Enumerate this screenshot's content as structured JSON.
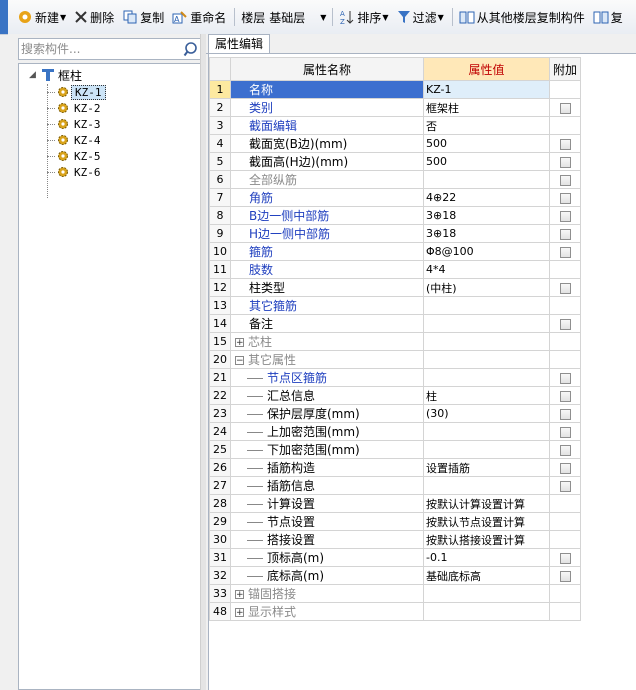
{
  "toolbar": {
    "new_label": "新建",
    "delete_label": "删除",
    "copy_label": "复制",
    "rename_label": "重命名",
    "floor_label": "楼层",
    "floor_value": "基础层",
    "sort_label": "排序",
    "filter_label": "过滤",
    "copy_from_floor_label": "从其他楼层复制构件",
    "last_label": "复"
  },
  "search": {
    "placeholder": "搜索构件..."
  },
  "tree": {
    "root_label": "框柱",
    "items": [
      {
        "label": "KZ-1",
        "selected": true
      },
      {
        "label": "KZ-2",
        "selected": false
      },
      {
        "label": "KZ-3",
        "selected": false
      },
      {
        "label": "KZ-4",
        "selected": false
      },
      {
        "label": "KZ-5",
        "selected": false
      },
      {
        "label": "KZ-6",
        "selected": false
      }
    ]
  },
  "panel": {
    "tab_label": "属性编辑",
    "headers": {
      "num": "",
      "name": "属性名称",
      "value": "属性值",
      "extra": "附加"
    }
  },
  "rows": [
    {
      "num": "1",
      "name": "名称",
      "value": "KZ-1",
      "color": "blue",
      "check": false,
      "selected": true
    },
    {
      "num": "2",
      "name": "类别",
      "value": "框架柱",
      "color": "blue",
      "check": true
    },
    {
      "num": "3",
      "name": "截面编辑",
      "value": "否",
      "color": "blue",
      "check": false
    },
    {
      "num": "4",
      "name": "截面宽(B边)(mm)",
      "value": "500",
      "color": "black",
      "check": true
    },
    {
      "num": "5",
      "name": "截面高(H边)(mm)",
      "value": "500",
      "color": "black",
      "check": true
    },
    {
      "num": "6",
      "name": "全部纵筋",
      "value": "",
      "color": "gray",
      "check": true
    },
    {
      "num": "7",
      "name": "角筋",
      "value": "4⊕22",
      "color": "blue",
      "check": true
    },
    {
      "num": "8",
      "name": "B边一侧中部筋",
      "value": "3⊕18",
      "color": "blue",
      "check": true
    },
    {
      "num": "9",
      "name": "H边一侧中部筋",
      "value": "3⊕18",
      "color": "blue",
      "check": true
    },
    {
      "num": "10",
      "name": "箍筋",
      "value": "Φ8@100",
      "color": "blue",
      "check": true
    },
    {
      "num": "11",
      "name": "肢数",
      "value": "4*4",
      "color": "blue",
      "check": false
    },
    {
      "num": "12",
      "name": "柱类型",
      "value": "(中柱)",
      "color": "black",
      "check": true
    },
    {
      "num": "13",
      "name": "其它箍筋",
      "value": "",
      "color": "blue",
      "check": false
    },
    {
      "num": "14",
      "name": "备注",
      "value": "",
      "color": "black",
      "check": true
    },
    {
      "num": "15",
      "name": "芯柱",
      "value": "",
      "color": "gray",
      "check": false,
      "expander": "+"
    },
    {
      "num": "20",
      "name": "其它属性",
      "value": "",
      "color": "gray",
      "check": false,
      "expander": "−"
    },
    {
      "num": "21",
      "name": "节点区箍筋",
      "value": "",
      "color": "blue",
      "check": true,
      "sub": true
    },
    {
      "num": "22",
      "name": "汇总信息",
      "value": "柱",
      "color": "black",
      "check": true,
      "sub": true
    },
    {
      "num": "23",
      "name": "保护层厚度(mm)",
      "value": "(30)",
      "color": "black",
      "check": true,
      "sub": true
    },
    {
      "num": "24",
      "name": "上加密范围(mm)",
      "value": "",
      "color": "black",
      "check": true,
      "sub": true
    },
    {
      "num": "25",
      "name": "下加密范围(mm)",
      "value": "",
      "color": "black",
      "check": true,
      "sub": true
    },
    {
      "num": "26",
      "name": "插筋构造",
      "value": "设置插筋",
      "color": "black",
      "check": true,
      "sub": true
    },
    {
      "num": "27",
      "name": "插筋信息",
      "value": "",
      "color": "black",
      "check": true,
      "sub": true
    },
    {
      "num": "28",
      "name": "计算设置",
      "value": "按默认计算设置计算",
      "color": "black",
      "check": false,
      "sub": true
    },
    {
      "num": "29",
      "name": "节点设置",
      "value": "按默认节点设置计算",
      "color": "black",
      "check": false,
      "sub": true
    },
    {
      "num": "30",
      "name": "搭接设置",
      "value": "按默认搭接设置计算",
      "color": "black",
      "check": false,
      "sub": true
    },
    {
      "num": "31",
      "name": "顶标高(m)",
      "value": "-0.1",
      "color": "black",
      "check": true,
      "sub": true
    },
    {
      "num": "32",
      "name": "底标高(m)",
      "value": "基础底标高",
      "color": "black",
      "check": true,
      "sub": true
    },
    {
      "num": "33",
      "name": "锚固搭接",
      "value": "",
      "color": "gray",
      "check": false,
      "expander": "+"
    },
    {
      "num": "48",
      "name": "显示样式",
      "value": "",
      "color": "gray",
      "check": false,
      "expander": "+"
    }
  ]
}
